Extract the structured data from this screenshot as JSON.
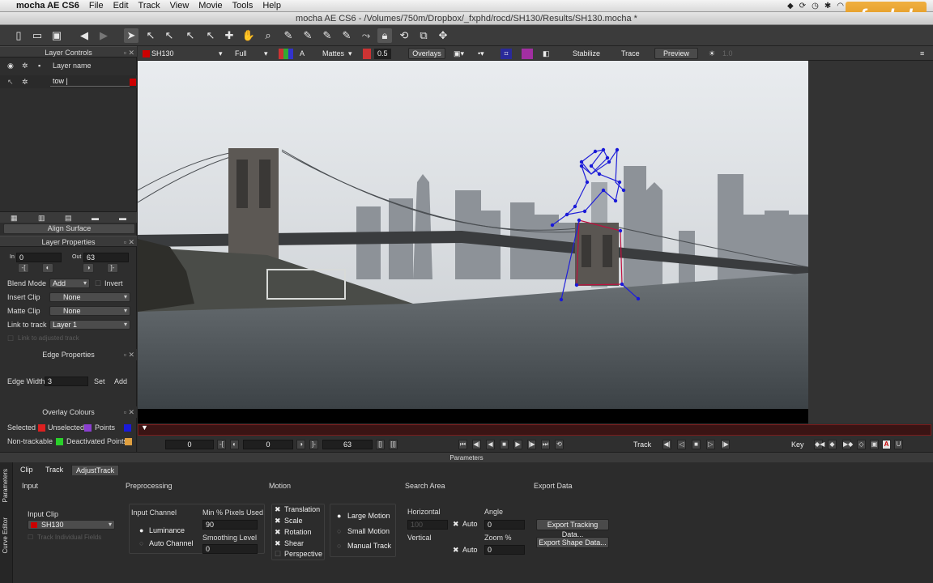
{
  "menubar": {
    "app_name": "mocha AE CS6",
    "items": [
      "File",
      "Edit",
      "Track",
      "View",
      "Movie",
      "Tools",
      "Help"
    ]
  },
  "window_title": "mocha AE CS6 - /Volumes/750m/Dropbox/_fxphd/rocd/SH130/Results/SH130.mocha *",
  "brand_logo": "fxphd",
  "layer_controls": {
    "header": "Layer Controls",
    "col_name": "Layer name",
    "layers": [
      {
        "name": "tow |",
        "color": "#cc0000"
      }
    ]
  },
  "align_surface_label": "Align Surface",
  "layer_properties": {
    "header": "Layer Properties",
    "in_label": "In",
    "in_value": "0",
    "out_label": "Out",
    "out_value": "63",
    "blend_mode_label": "Blend Mode",
    "blend_mode_value": "Add",
    "invert_label": "Invert",
    "insert_clip_label": "Insert Clip",
    "insert_clip_value": "None",
    "matte_clip_label": "Matte Clip",
    "matte_clip_value": "None",
    "link_to_track_label": "Link to track",
    "link_to_track_value": "Layer 1",
    "link_adjusted_label": "Link to adjusted track"
  },
  "edge_properties": {
    "header": "Edge Properties",
    "edge_width_label": "Edge Width",
    "edge_width_value": "3",
    "set_label": "Set",
    "add_label": "Add"
  },
  "overlay_colours": {
    "header": "Overlay Colours",
    "selected_label": "Selected",
    "unselected_label": "Unselected",
    "points_label": "Points",
    "nontrackable_label": "Non-trackable",
    "deactivated_label": "Deactivated Points",
    "selected_color": "#dd2020",
    "unselected_color": "#dd2020",
    "points_color": "#8a3fd0",
    "points_swatch2": "#1a1ad8",
    "nontrackable_color": "#2ad02a",
    "deactivated_color": "#e0a040"
  },
  "viewer_header": {
    "clip": "SH130",
    "resolution": "Full",
    "mattes": "Mattes",
    "opacity": "0.5",
    "overlays": "Overlays",
    "stabilize": "Stabilize",
    "trace": "Trace",
    "preview": "Preview",
    "exposure": "1.0"
  },
  "timeline": {
    "in_frame": "0",
    "current_frame": "0",
    "out_frame": "63",
    "track_label": "Track",
    "key_label": "Key"
  },
  "params_header": "Parameters",
  "side_tabs": [
    "Parameters",
    "Curve Editor"
  ],
  "param_tabs": [
    "Clip",
    "Track",
    "AdjustTrack"
  ],
  "params": {
    "input_section": "Input",
    "input_clip_label": "Input Clip",
    "input_clip_value": "SH130",
    "track_individual_fields": "Track Individual Fields",
    "preprocessing_section": "Preprocessing",
    "input_channel_label": "Input Channel",
    "luminance": "Luminance",
    "auto_channel": "Auto Channel",
    "min_pixels_label": "Min % Pixels Used",
    "min_pixels_value": "90",
    "smoothing_label": "Smoothing Level",
    "smoothing_value": "0",
    "motion_section": "Motion",
    "translation": "Translation",
    "scale": "Scale",
    "rotation": "Rotation",
    "shear": "Shear",
    "perspective": "Perspective",
    "large_motion": "Large Motion",
    "small_motion": "Small Motion",
    "manual_track": "Manual Track",
    "search_area_section": "Search Area",
    "horizontal_label": "Horizontal",
    "horizontal_value": "100",
    "vertical_label": "Vertical",
    "auto_label": "Auto",
    "angle_label": "Angle",
    "angle_value": "0",
    "zoom_label": "Zoom %",
    "zoom_value": "0",
    "export_section": "Export Data",
    "export_tracking": "Export Tracking Data...",
    "export_shape": "Export Shape Data..."
  }
}
